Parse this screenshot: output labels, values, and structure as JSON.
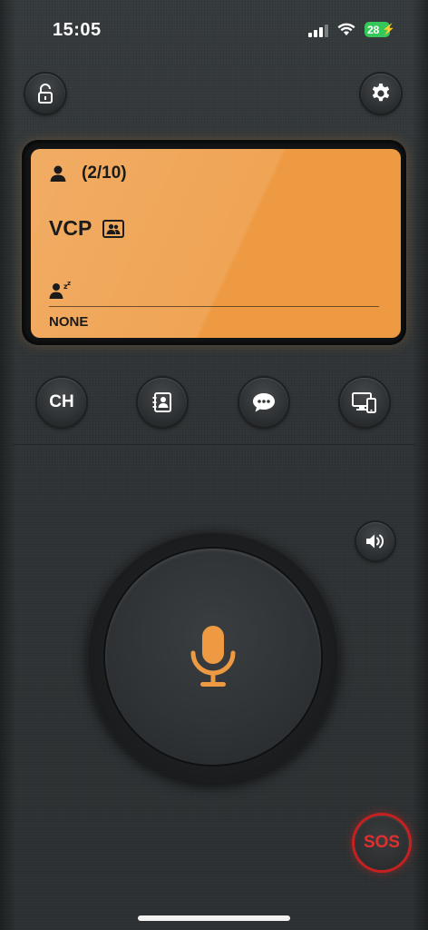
{
  "status_bar": {
    "time": "15:05",
    "battery_level": "28",
    "battery_color": "#35c759",
    "icons": [
      "cellular-signal-icon",
      "wifi-icon",
      "charging-bolt-icon"
    ]
  },
  "top_controls": {
    "lock_icon": "unlock-icon",
    "settings_icon": "gear-icon"
  },
  "display": {
    "accent_color": "#ee9a42",
    "user_count": "(2/10)",
    "channel_name": "VCP",
    "idle_status": "NONE",
    "icons": [
      "user-icon",
      "group-icon",
      "sleeping-user-icon"
    ]
  },
  "action_row": {
    "channel_label": "CH",
    "icons": [
      "contacts-icon",
      "chat-icon",
      "devices-icon"
    ]
  },
  "speaker_icon": "speaker-icon",
  "ptt": {
    "icon": "microphone-icon",
    "mic_color": "#ee9a42"
  },
  "sos": {
    "label": "SOS",
    "ring_color": "#c62020"
  }
}
